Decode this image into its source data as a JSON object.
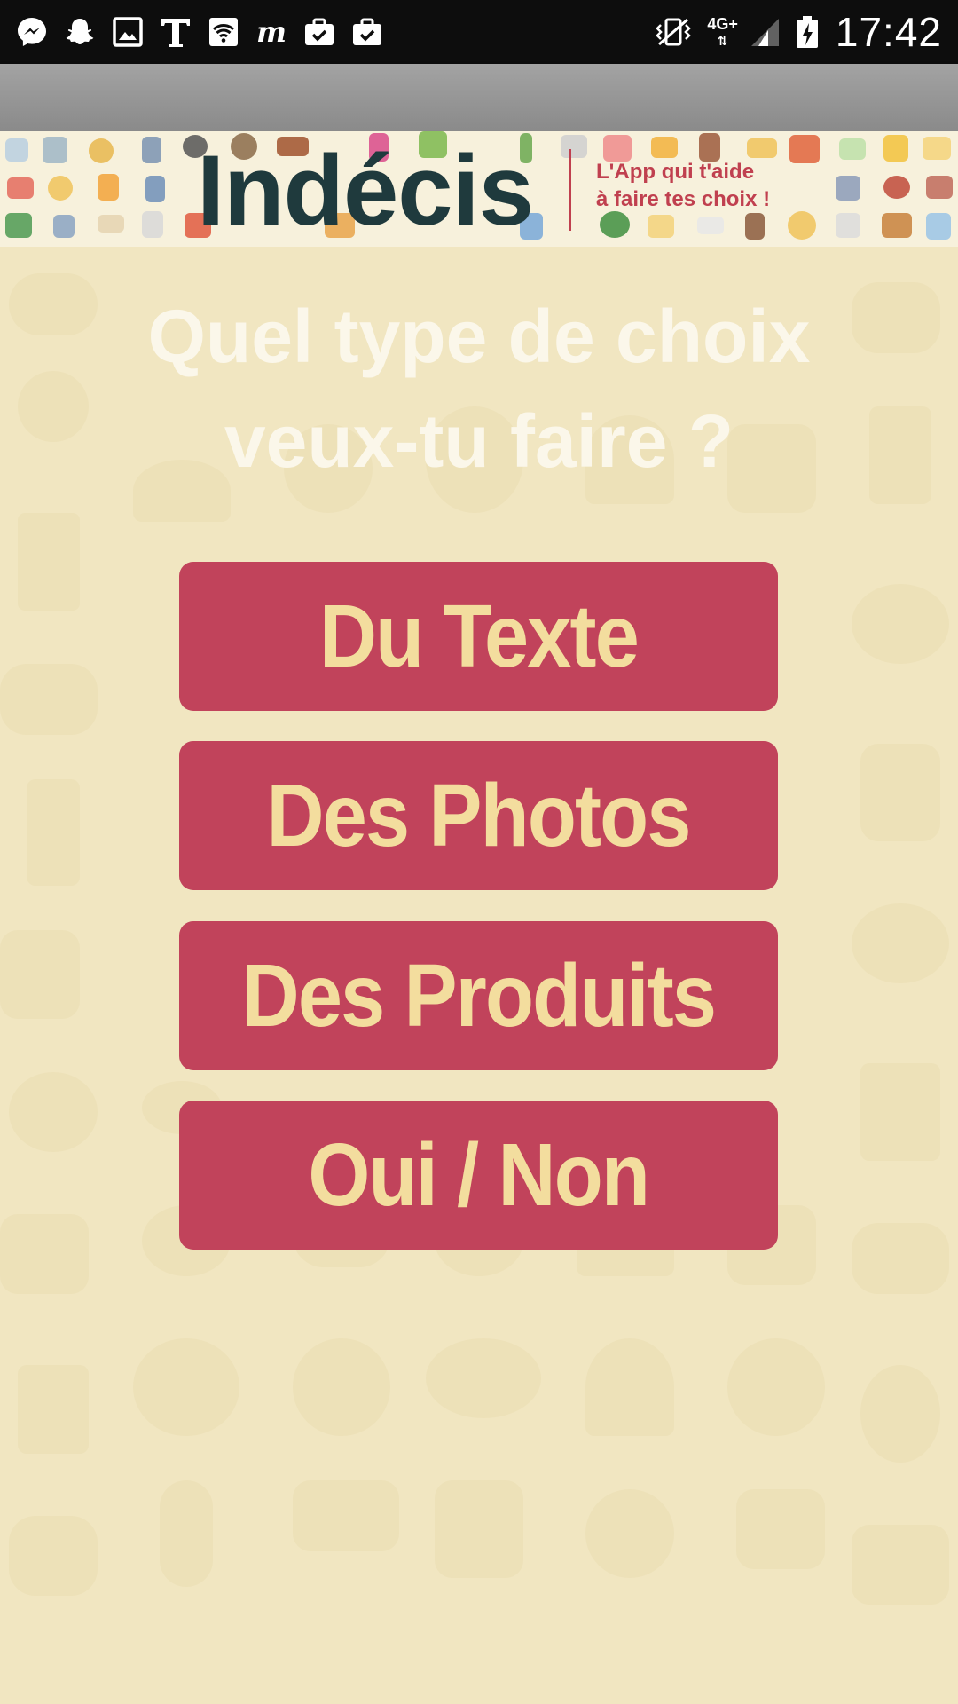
{
  "status_bar": {
    "time": "17:42",
    "network": "4G+",
    "left_icons": [
      "messenger-icon",
      "snapchat-icon",
      "image-icon",
      "text-t-icon",
      "wifi-icon",
      "news-m-icon",
      "briefcase-check-icon",
      "briefcase-check-icon"
    ],
    "right_icons": [
      "vibrate-icon",
      "network-4g-icon",
      "signal-icon",
      "battery-charging-icon"
    ]
  },
  "banner": {
    "app_name": "Indécis",
    "tagline_line1": "L'App qui t'aide",
    "tagline_line2": "à faire tes choix !"
  },
  "main": {
    "question_line1": "Quel type de choix",
    "question_line2": "veux-tu faire ?",
    "options": [
      {
        "label": "Du Texte"
      },
      {
        "label": "Des Photos"
      },
      {
        "label": "Des Produits"
      },
      {
        "label": "Oui / Non"
      }
    ]
  },
  "colors": {
    "status_bar": "#0d0d0d",
    "action_bar": "#929292",
    "background": "#f1e6c1",
    "button": "#c1435b",
    "button_text": "#f3dd9e",
    "logo": "#1f3a3d",
    "tagline": "#c0404f",
    "question_text": "#fbf7ea"
  }
}
